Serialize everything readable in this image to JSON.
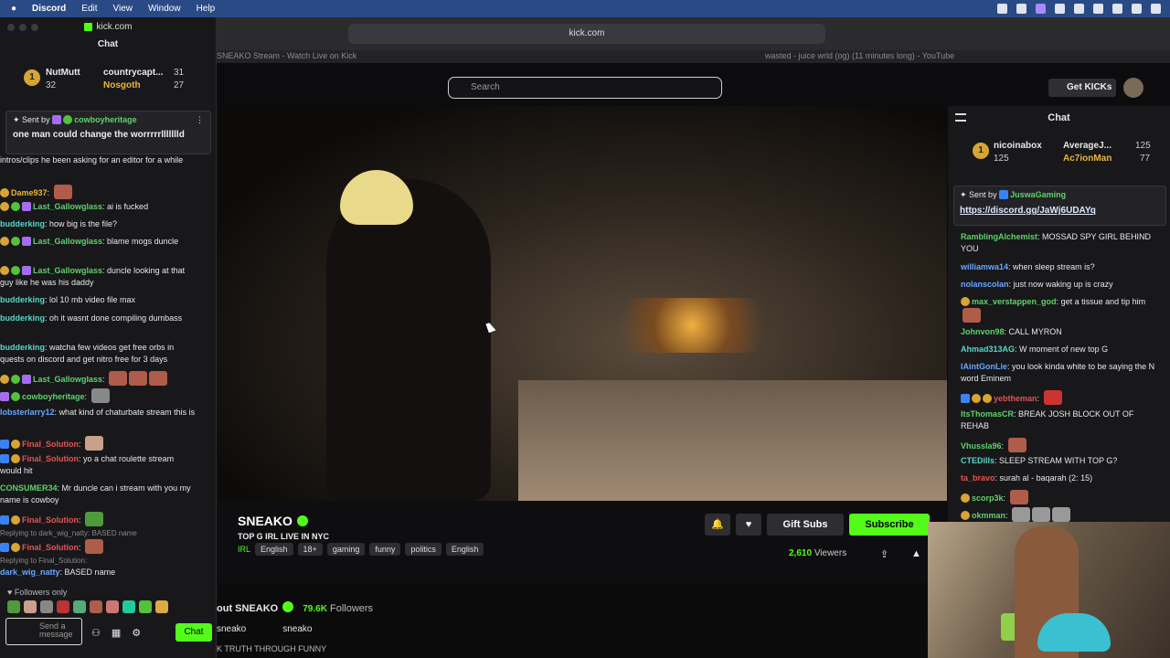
{
  "menubar": {
    "app": "Discord",
    "items": [
      "Edit",
      "View",
      "Window",
      "Help"
    ]
  },
  "left": {
    "site": "kick.com",
    "chat_title": "Chat",
    "gifter1": {
      "name": "NutMutt",
      "count": "32"
    },
    "gifter2": {
      "name": "countrycapt...",
      "count": "31"
    },
    "gifter3": {
      "name": "Nosgoth",
      "count": "27"
    },
    "pinned": {
      "sent_by": "Sent by",
      "user": "cowboyheritage",
      "message": "one man could change the worrrrrllllllld"
    },
    "messages": [
      {
        "user": "",
        "text": "intros/clips he been asking for an editor for a while"
      },
      {
        "user": "Dame937",
        "text": ""
      },
      {
        "user": "Last_Gallowglass",
        "text": "ai is fucked"
      },
      {
        "user": "budderking",
        "text": "how big is the file?"
      },
      {
        "user": "Last_Gallowglass",
        "text": "blame mogs duncle"
      },
      {
        "user": "Last_Gallowglass",
        "text": "duncle looking at that guy like he was his daddy"
      },
      {
        "user": "budderking",
        "text": "lol 10 mb video file max"
      },
      {
        "user": "budderking",
        "text": "oh it wasnt done compiling dumbass"
      },
      {
        "user": "budderking",
        "text": "watcha few videos get free orbs in quests on discord and get nitro free for 3 days"
      },
      {
        "user": "Last_Gallowglass",
        "text": ""
      },
      {
        "user": "cowboyheritage",
        "text": ""
      },
      {
        "user": "lobsterlarry12",
        "text": "what kind of chaturbate stream this is"
      },
      {
        "user": "Final_Solution",
        "text": ""
      },
      {
        "user": "Final_Solution",
        "text": "yo a chat roulette stream would hit"
      },
      {
        "user": "CONSUMER34",
        "text": "Mr duncle can i stream with you my name is cowboy"
      },
      {
        "user": "Final_Solution",
        "text": ""
      },
      {
        "user": "",
        "text": "Replying to dark_wig_natty: BASED name"
      },
      {
        "user": "Final_Solution",
        "text": ""
      },
      {
        "user": "",
        "text": "Replying to Final_Solution:"
      },
      {
        "user": "dark_wig_natty",
        "text": "BASED name"
      }
    ],
    "followers_only": "Followers only",
    "send_placeholder": "Send a message",
    "chat_button": "Chat"
  },
  "browser": {
    "url": "kick.com",
    "tab1": "SNEAKO Stream - Watch Live on Kick",
    "tab2": "wasted - juice wrld (og) (11 minutes long) - YouTube",
    "search_placeholder": "Search",
    "get_kicks": "Get KICKs"
  },
  "stream": {
    "name": "SNEAKO",
    "title": "TOP G IRL LIVE IN NYC",
    "category": "IRL",
    "tags": [
      "English",
      "18+",
      "gaming",
      "funny",
      "politics",
      "English"
    ],
    "gift_subs": "Gift Subs",
    "subscribe": "Subscribe",
    "viewers": "2,610",
    "viewers_label": "Viewers",
    "about_title": "out SNEAKO",
    "followers": "79.6K",
    "followers_label": "Followers",
    "social1": "sneako",
    "social2": "sneako",
    "desc": "K TRUTH THROUGH FUNNY"
  },
  "right": {
    "chat_title": "Chat",
    "gifter1": {
      "name": "nicoinabox",
      "count": "125"
    },
    "gifter2": {
      "name": "AverageJ...",
      "count": "125"
    },
    "gifter3": {
      "name": "Ac7ionMan",
      "count": "77"
    },
    "pinned": {
      "sent_by": "Sent by",
      "user": "JuswaGaming",
      "link": "https://discord.gg/JaWj6UDAYq"
    },
    "messages": [
      {
        "user": "RamblingAlchemist",
        "text": "MOSSAD SPY GIRL BEHIND YOU"
      },
      {
        "user": "williamwa14",
        "text": "when sleep stream is?"
      },
      {
        "user": "nolanscolan",
        "text": "just now waking up is crazy"
      },
      {
        "user": "max_verstappen_god",
        "text": "get a tissue and tip him"
      },
      {
        "user": "Johnvon98",
        "text": "CALL MYRON"
      },
      {
        "user": "Ahmad313AG",
        "text": "W moment of new top G"
      },
      {
        "user": "IAintGonLie",
        "text": "you look kinda white to be saying the N word Eminem"
      },
      {
        "user": "yebtheman",
        "text": ""
      },
      {
        "user": "ItsThomasCR",
        "text": "BREAK JOSH BLOCK OUT OF REHAB"
      },
      {
        "user": "Vhussla96",
        "text": ""
      },
      {
        "user": "CTEDills",
        "text": "SLEEP STREAM WITH TOP G?"
      },
      {
        "user": "ta_bravo",
        "text": "surah al - baqarah (2: 15)"
      },
      {
        "user": "scorp3k",
        "text": ""
      },
      {
        "user": "okmman",
        "text": ""
      }
    ]
  }
}
